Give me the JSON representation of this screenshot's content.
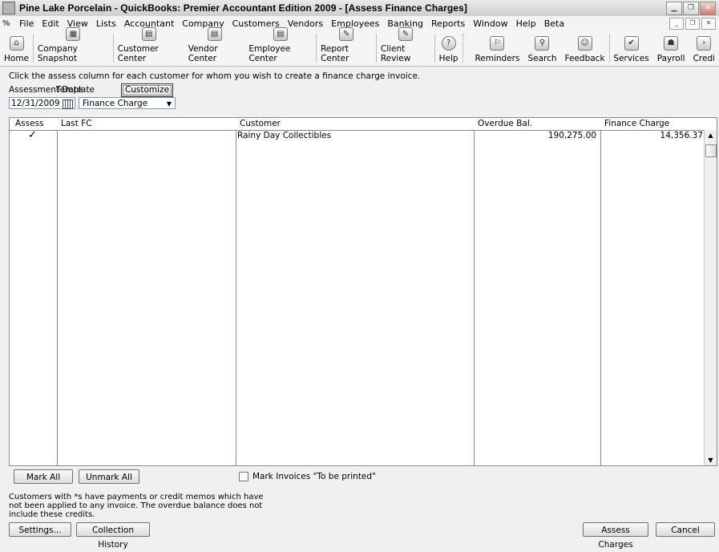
{
  "window": {
    "title": "Pine Lake Porcelain  - QuickBooks: Premier Accountant Edition 2009 - [Assess Finance Charges]"
  },
  "menu": [
    "File",
    "Edit",
    "View",
    "Lists",
    "Accountant",
    "Company",
    "Customers",
    "Vendors",
    "Employees",
    "Banking",
    "Reports",
    "Window",
    "Help",
    "Beta"
  ],
  "toolbar": {
    "items": [
      {
        "label": "Home",
        "icon": "home-icon"
      },
      {
        "label": "Company Snapshot",
        "icon": "snapshot-icon"
      },
      {
        "label": "Customer Center",
        "icon": "customer-center-icon"
      },
      {
        "label": "Vendor Center",
        "icon": "vendor-center-icon"
      },
      {
        "label": "Employee Center",
        "icon": "employee-center-icon"
      },
      {
        "label": "Report Center",
        "icon": "report-center-icon"
      },
      {
        "label": "Client Review",
        "icon": "client-review-icon"
      },
      {
        "label": "Help",
        "icon": "help-icon"
      },
      {
        "label": "Reminders",
        "icon": "reminders-icon"
      },
      {
        "label": "Search",
        "icon": "search-icon"
      },
      {
        "label": "Feedback",
        "icon": "feedback-icon"
      },
      {
        "label": "Services",
        "icon": "services-icon"
      },
      {
        "label": "Payroll",
        "icon": "payroll-icon"
      },
      {
        "label": "Credi",
        "icon": "credit-icon"
      }
    ]
  },
  "form": {
    "instructions": "Click the assess column for each customer for whom you wish to create a finance charge invoice.",
    "assessment_date_label": "Assessment Date",
    "assessment_date": "12/31/2009",
    "template_label": "Template",
    "template_value": "Finance Charge",
    "customize_label": "Customize"
  },
  "table": {
    "columns": [
      "Assess",
      "Last FC",
      "Customer",
      "Overdue Bal.",
      "Finance Charge"
    ],
    "rows": [
      {
        "assess": "✓",
        "last_fc": "",
        "customer": "Rainy Day Collectibles",
        "overdue_bal": "190,275.00",
        "finance_charge": "14,356.37"
      }
    ]
  },
  "buttons": {
    "mark_all": "Mark All",
    "unmark_all": "Unmark All",
    "settings": "Settings...",
    "collection_history": "Collection History",
    "assess_charges": "Assess Charges",
    "cancel": "Cancel"
  },
  "mark_to_print_label": "Mark Invoices \"To be printed\"",
  "note": "Customers with *s have payments or credit memos which have not been applied to any invoice.  The overdue balance does not include these credits."
}
